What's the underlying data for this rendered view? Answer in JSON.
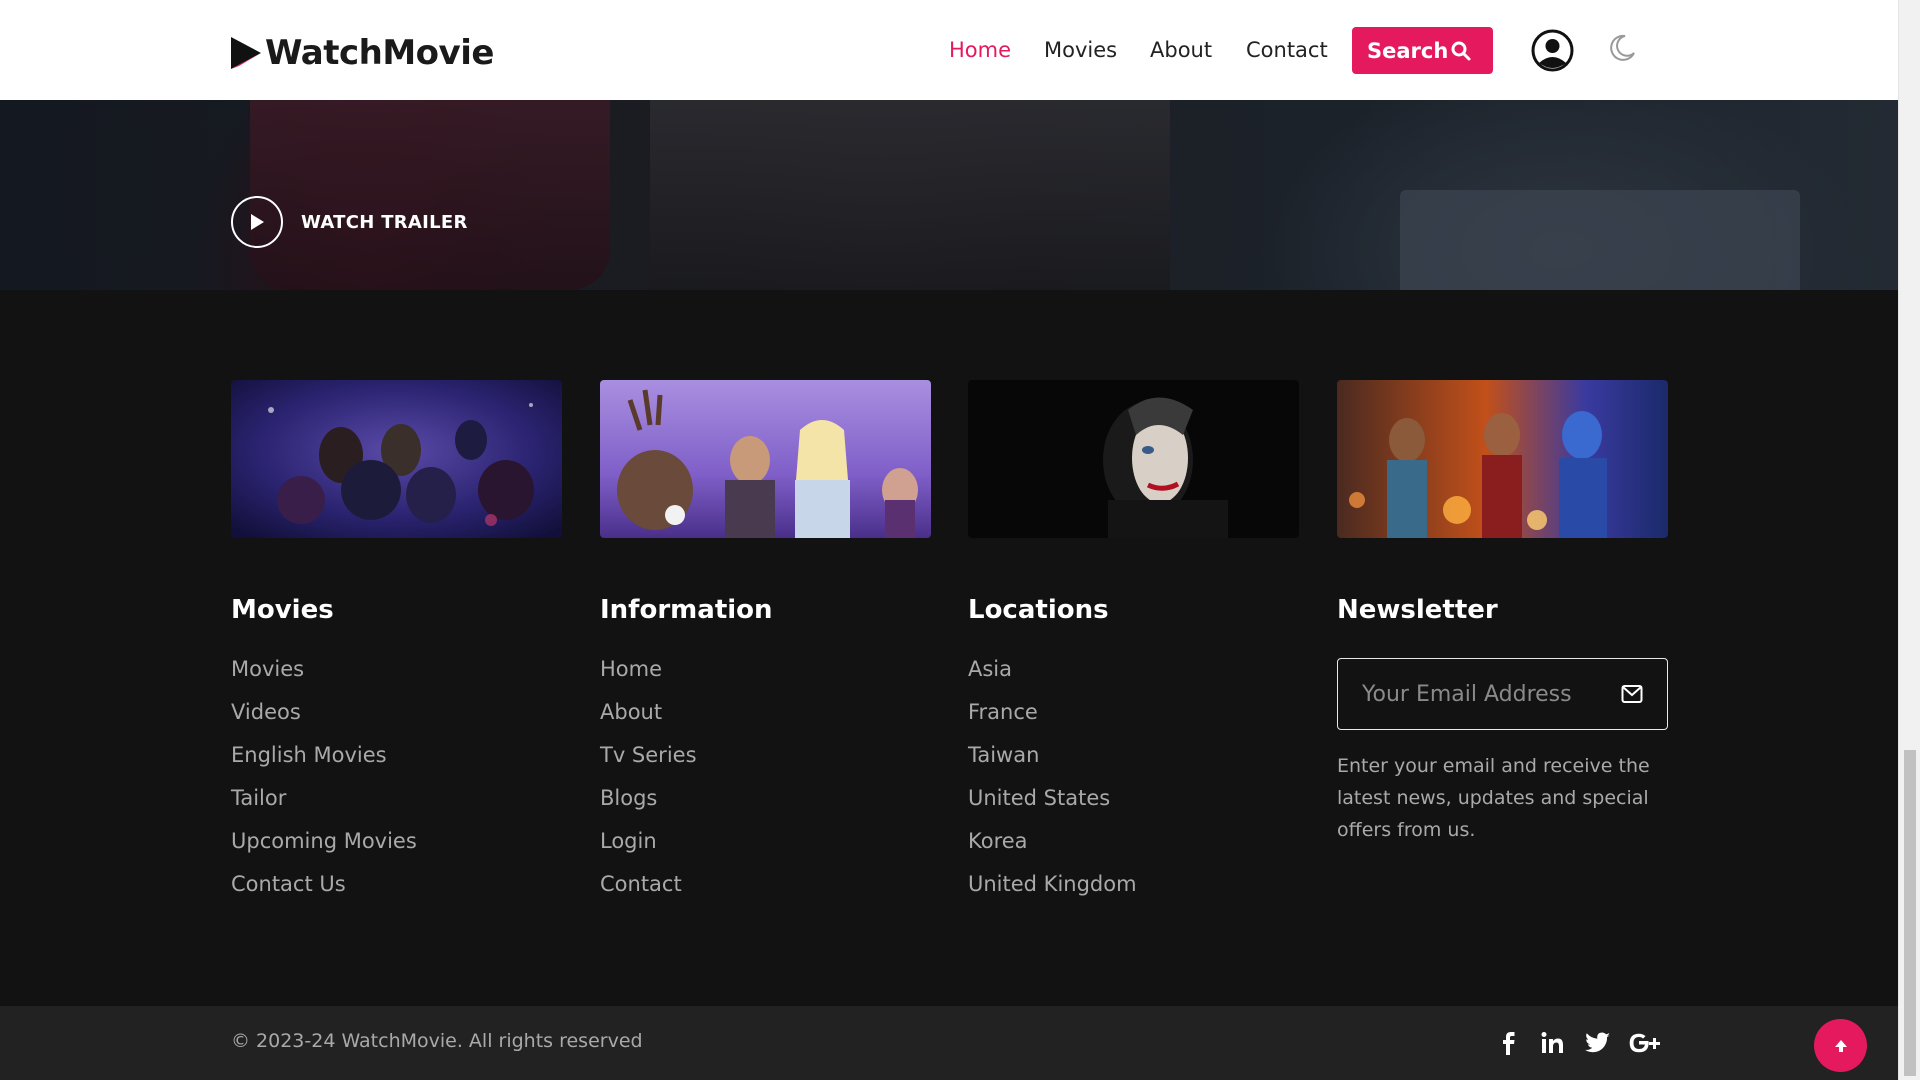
{
  "header": {
    "brand": "WatchMovie",
    "nav": [
      {
        "label": "Home",
        "active": true
      },
      {
        "label": "Movies",
        "active": false
      },
      {
        "label": "About",
        "active": false
      },
      {
        "label": "Contact",
        "active": false
      }
    ],
    "search_label": "Search",
    "icons": {
      "search": "search-icon",
      "user": "user-circle-icon",
      "theme": "moon-icon"
    },
    "accent_color": "#e5195e"
  },
  "hero": {
    "trailer_label": "WATCH TRAILER"
  },
  "footer": {
    "thumbnails": [
      {
        "name": "avengers-thumbnail"
      },
      {
        "name": "frozen-thumbnail"
      },
      {
        "name": "joker-thumbnail"
      },
      {
        "name": "aladdin-thumbnail"
      }
    ],
    "columns": [
      {
        "title": "Movies",
        "links": [
          "Movies",
          "Videos",
          "English Movies",
          "Tailor",
          "Upcoming Movies",
          "Contact Us"
        ]
      },
      {
        "title": "Information",
        "links": [
          "Home",
          "About",
          "Tv Series",
          "Blogs",
          "Login",
          "Contact"
        ]
      },
      {
        "title": "Locations",
        "links": [
          "Asia",
          "France",
          "Taiwan",
          "United States",
          "Korea",
          "United Kingdom"
        ]
      }
    ],
    "newsletter": {
      "title": "Newsletter",
      "placeholder": "Your Email Address",
      "description": "Enter your email and receive the latest news, updates and special offers from us."
    }
  },
  "bottom": {
    "copyright": "© 2023-24 WatchMovie. All rights reserved",
    "social": [
      "facebook-icon",
      "linkedin-icon",
      "twitter-icon",
      "google-plus-icon"
    ]
  }
}
